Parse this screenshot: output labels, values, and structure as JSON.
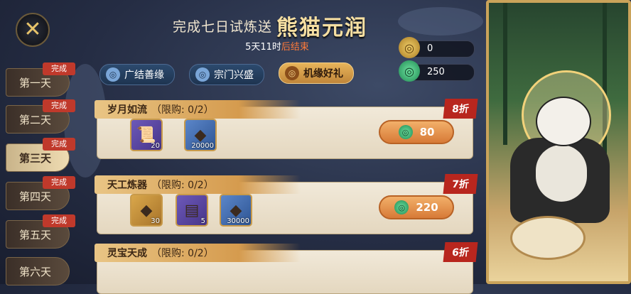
{
  "header": {
    "title_prefix": "完成七日试炼送",
    "title_main": "熊猫元润",
    "countdown_value": "5天11时",
    "countdown_suffix": "后结束"
  },
  "currency": [
    {
      "icon": "gold-coin-icon",
      "value": "0"
    },
    {
      "icon": "jade-icon",
      "value": "250"
    }
  ],
  "days": [
    {
      "label": "第一天",
      "badge": "完成"
    },
    {
      "label": "第二天",
      "badge": "完成"
    },
    {
      "label": "第三天",
      "badge": "完成",
      "active": true
    },
    {
      "label": "第四天",
      "badge": "完成"
    },
    {
      "label": "第五天",
      "badge": "完成"
    },
    {
      "label": "第六天",
      "badge": ""
    }
  ],
  "tabs": [
    {
      "label": "广结善缘"
    },
    {
      "label": "宗门兴盛"
    },
    {
      "label": "机缘好礼",
      "active": true
    }
  ],
  "offers": [
    {
      "name": "岁月如流",
      "limit": "（限购: 0/2）",
      "discount": "8折",
      "price": "80",
      "items": [
        {
          "icon": "scroll-icon",
          "qty": "20"
        },
        {
          "icon": "spirit-stone-icon",
          "qty": "20000"
        }
      ]
    },
    {
      "name": "天工炼器",
      "limit": "（限购: 0/2）",
      "discount": "7折",
      "price": "220",
      "items": [
        {
          "icon": "crystal-icon",
          "qty": "30"
        },
        {
          "icon": "iron-ingot-icon",
          "qty": "5"
        },
        {
          "icon": "spirit-stone-icon",
          "qty": "30000"
        }
      ]
    },
    {
      "name": "灵宝天成",
      "limit": "（限购: 0/2）",
      "discount": "6折",
      "price": "",
      "items": []
    }
  ],
  "colors": {
    "accent": "#e7b45a",
    "badge": "#c0392b",
    "discount": "#b8261e",
    "buy_button": "#d77a37"
  }
}
